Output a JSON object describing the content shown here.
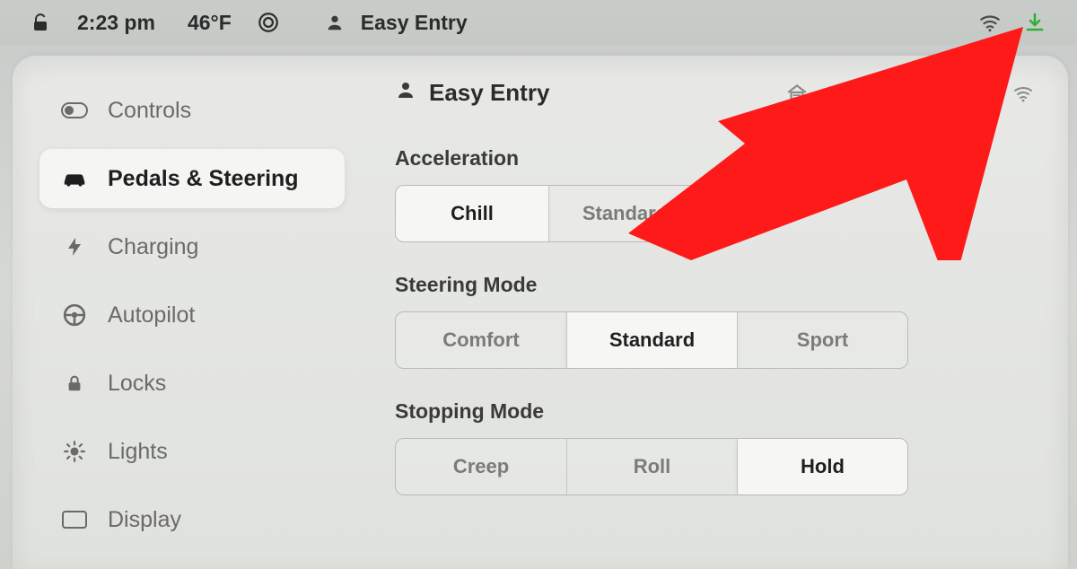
{
  "status": {
    "time": "2:23 pm",
    "temperature": "46°F",
    "profile": "Easy Entry"
  },
  "panel": {
    "profile_title": "Easy Entry",
    "sidebar": {
      "items": [
        {
          "label": "Controls"
        },
        {
          "label": "Pedals & Steering"
        },
        {
          "label": "Charging"
        },
        {
          "label": "Autopilot"
        },
        {
          "label": "Locks"
        },
        {
          "label": "Lights"
        },
        {
          "label": "Display"
        }
      ],
      "active_index": 1
    },
    "sections": {
      "acceleration": {
        "title": "Acceleration",
        "options": [
          "Chill",
          "Standard"
        ],
        "selected_index": 0
      },
      "steering_mode": {
        "title": "Steering Mode",
        "options": [
          "Comfort",
          "Standard",
          "Sport"
        ],
        "selected_index": 1
      },
      "stopping_mode": {
        "title": "Stopping Mode",
        "options": [
          "Creep",
          "Roll",
          "Hold"
        ],
        "selected_index": 2
      }
    }
  },
  "annotation": {
    "arrow_color": "#ff1a1a"
  }
}
